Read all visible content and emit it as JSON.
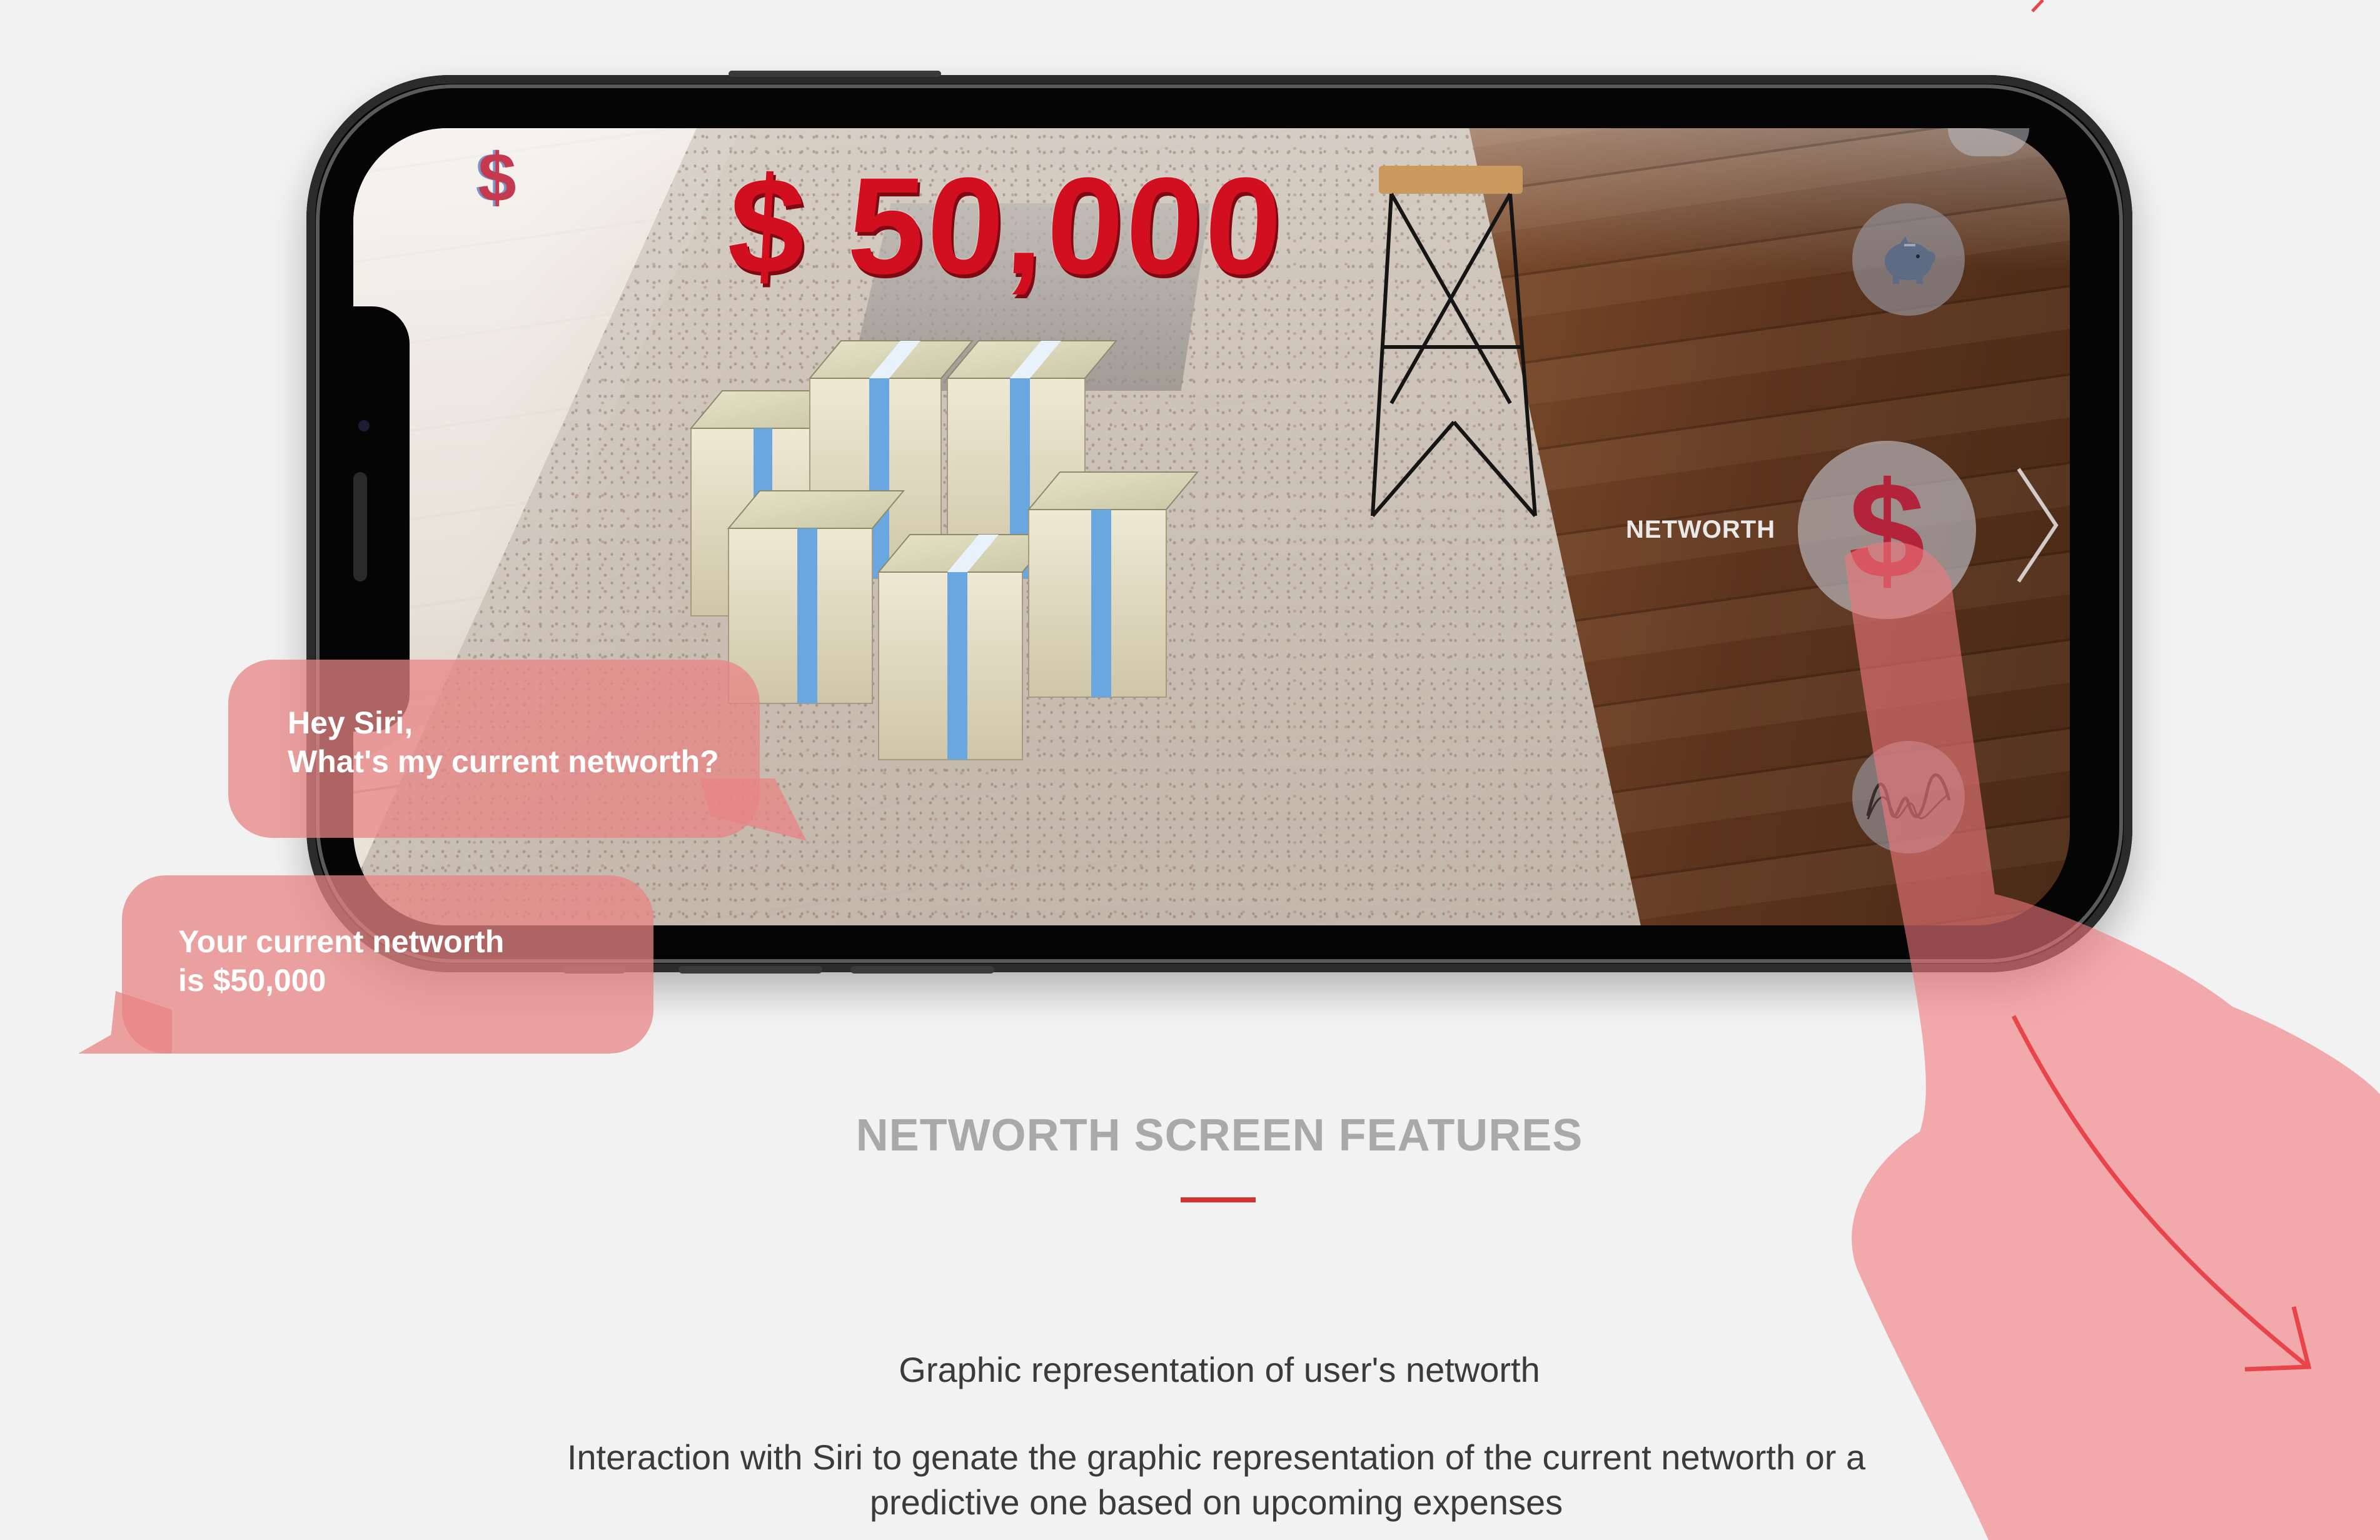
{
  "ar_screen": {
    "amount": "$ 50,000",
    "app_logo": "$",
    "networth_label": "NETWORTH",
    "buttons": {
      "savings_icon": "piggy-bank-icon",
      "networth_icon": "$",
      "chart_icon": "line-chart-icon"
    }
  },
  "conversation": {
    "user_line1": "Hey Siri,",
    "user_line2": "What's my current networth?",
    "siri_line1": "Your current networth",
    "siri_line2": "is $50,000"
  },
  "section": {
    "title": "NETWORTH SCREEN FEATURES",
    "feature_1": "Graphic representation of user's networth",
    "feature_2": "Interaction with Siri to genate the graphic representation of the current networth or a predictive one based on upcoming expenses"
  },
  "colors": {
    "background": "#f2f2f2",
    "accent": "#d8322e",
    "amount_red": "#d10f1f",
    "bubble": "#e88484"
  }
}
